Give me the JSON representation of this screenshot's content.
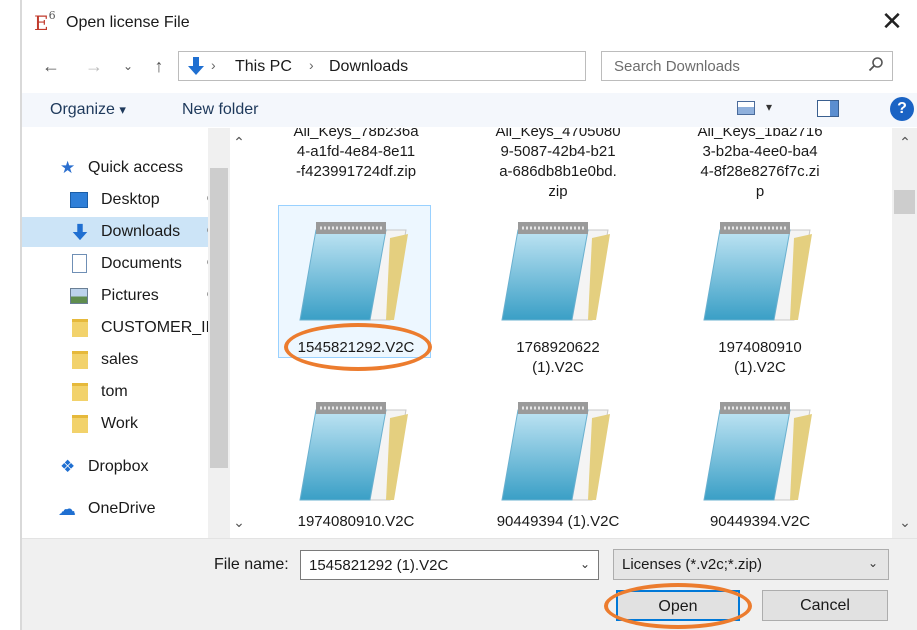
{
  "window": {
    "logo_text": "E",
    "logo_sup": "6",
    "title": "Open license File",
    "close_glyph": "✕"
  },
  "address": {
    "crumbs": [
      "This PC",
      "Downloads"
    ],
    "search_placeholder": "Search Downloads"
  },
  "toolbar": {
    "organize": "Organize",
    "organize_caret": "▾",
    "new_folder": "New folder",
    "help": "?"
  },
  "nav": {
    "quick_access": "Quick access",
    "items": [
      {
        "label": "Desktop",
        "pinned": true
      },
      {
        "label": "Downloads",
        "pinned": true,
        "selected": true
      },
      {
        "label": "Documents",
        "pinned": true
      },
      {
        "label": "Pictures",
        "pinned": true
      },
      {
        "label": "CUSTOMER_INFO",
        "pinned": false
      },
      {
        "label": "sales",
        "pinned": false
      },
      {
        "label": "tom",
        "pinned": false
      },
      {
        "label": "Work",
        "pinned": false
      }
    ],
    "dropbox": "Dropbox",
    "onedrive": "OneDrive",
    "pin_glyph": "📌"
  },
  "files": {
    "top_row_partial": [
      [
        "All_Keys_78b236a",
        "4-a1fd-4e84-8e11",
        "-f423991724df.zip"
      ],
      [
        "All_Keys_4705080",
        "9-5087-42b4-b21",
        "a-686db8b1e0bd.",
        "zip"
      ],
      [
        "All_Keys_1ba2716",
        "3-b2ba-4ee0-ba4",
        "4-8f28e8276f7c.zi",
        "p"
      ]
    ],
    "row2": [
      [
        "1545821292.V2C"
      ],
      [
        "1768920622",
        "(1).V2C"
      ],
      [
        "1974080910",
        "(1).V2C"
      ]
    ],
    "row3": [
      [
        "1974080910.V2C"
      ],
      [
        "90449394 (1).V2C"
      ],
      [
        "90449394.V2C"
      ]
    ]
  },
  "footer": {
    "file_name_label": "File name:",
    "file_name_value": "1545821292 (1).V2C",
    "filter_value": "Licenses (*.v2c;*.zip)",
    "open": "Open",
    "cancel": "Cancel"
  },
  "colors": {
    "annotation_ring": "#ec7c2e",
    "accent": "#0078d7",
    "selected_nav": "#cce4f7"
  }
}
